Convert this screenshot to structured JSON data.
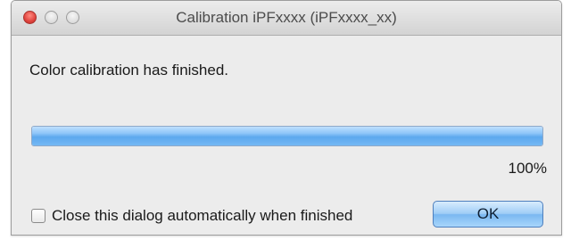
{
  "window": {
    "title": "Calibration iPFxxxx (iPFxxxx_xx)"
  },
  "message": "Color calibration has finished.",
  "progress": {
    "value_percent": 100,
    "label": "100%",
    "fill_color": "#6aaef0"
  },
  "auto_close": {
    "label": "Close this dialog automatically when finished",
    "checked": false
  },
  "ok_button": {
    "label": "OK"
  },
  "colors": {
    "close_button": "#e0443e",
    "accent": "#7ab8f1"
  }
}
